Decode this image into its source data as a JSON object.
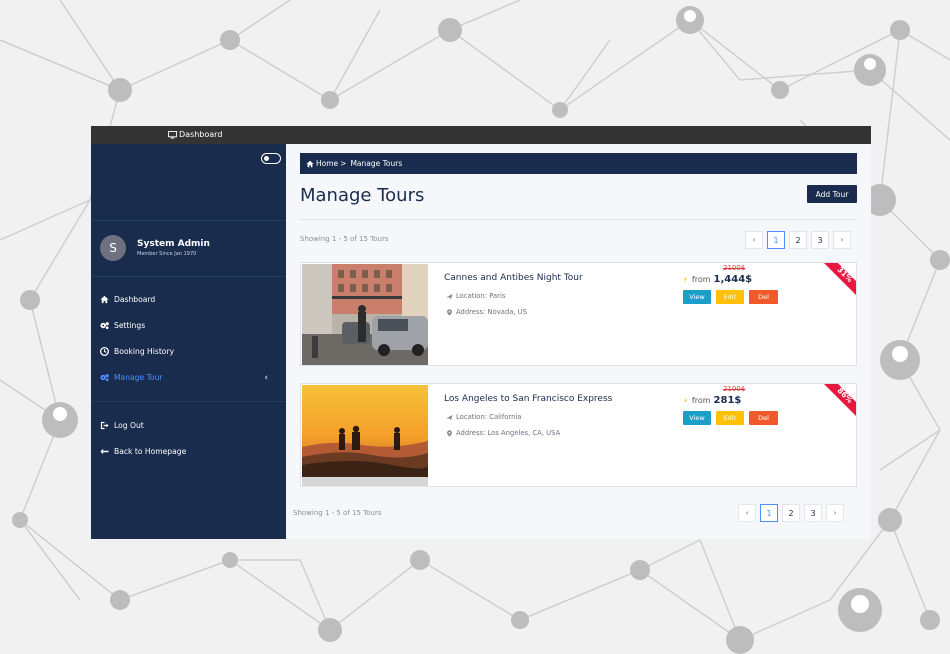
{
  "topbar": {
    "brand": "Dashboard"
  },
  "sidebar": {
    "avatar_letter": "S",
    "user_name": "System Admin",
    "user_sub": "Member Since Jan 1970",
    "items": [
      {
        "label": "Dashboard",
        "icon": "home-icon"
      },
      {
        "label": "Settings",
        "icon": "gears-icon"
      },
      {
        "label": "Booking History",
        "icon": "clock-icon"
      },
      {
        "label": "Manage Tour",
        "icon": "gears-icon",
        "active": true
      },
      {
        "label": "Log Out",
        "icon": "logout-icon"
      },
      {
        "label": "Back to Homepage",
        "icon": "arrow-left-icon"
      }
    ],
    "active_color": "#4d8eff",
    "bg_color": "#1a2c4d"
  },
  "breadcrumb": {
    "home": "Home",
    "separator": ">",
    "current": "Manage Tours"
  },
  "page": {
    "title": "Manage Tours",
    "add_button": "Add Tour",
    "showing_top": "Showing 1 - 5 of 15 Tours",
    "showing_bottom": "Showing 1 - 5 of 15 Tours"
  },
  "pagination": {
    "prev": "‹",
    "next": "›",
    "pages": [
      "1",
      "2",
      "3"
    ],
    "current": "1"
  },
  "tours": [
    {
      "name": "Cannes and Antibes Night Tour",
      "location": "Location: Paris",
      "address": "Address: Novada, US",
      "old_price": "2100$",
      "from_label": "from",
      "price": "1,444$",
      "discount": "31%",
      "view": "View",
      "edit": "Edit",
      "del": "Del"
    },
    {
      "name": "Los Angeles to San Francisco Express",
      "location": "Location: California",
      "address": "Address: Los Angeles, CA, USA",
      "old_price": "2100$",
      "from_label": "from",
      "price": "281$",
      "discount": "86%",
      "view": "View",
      "edit": "Edit",
      "del": "Del"
    }
  ],
  "colors": {
    "view": "#1aa0c8",
    "edit": "#ffc107",
    "del": "#f05a2a",
    "ribbon": "#e8173f"
  }
}
